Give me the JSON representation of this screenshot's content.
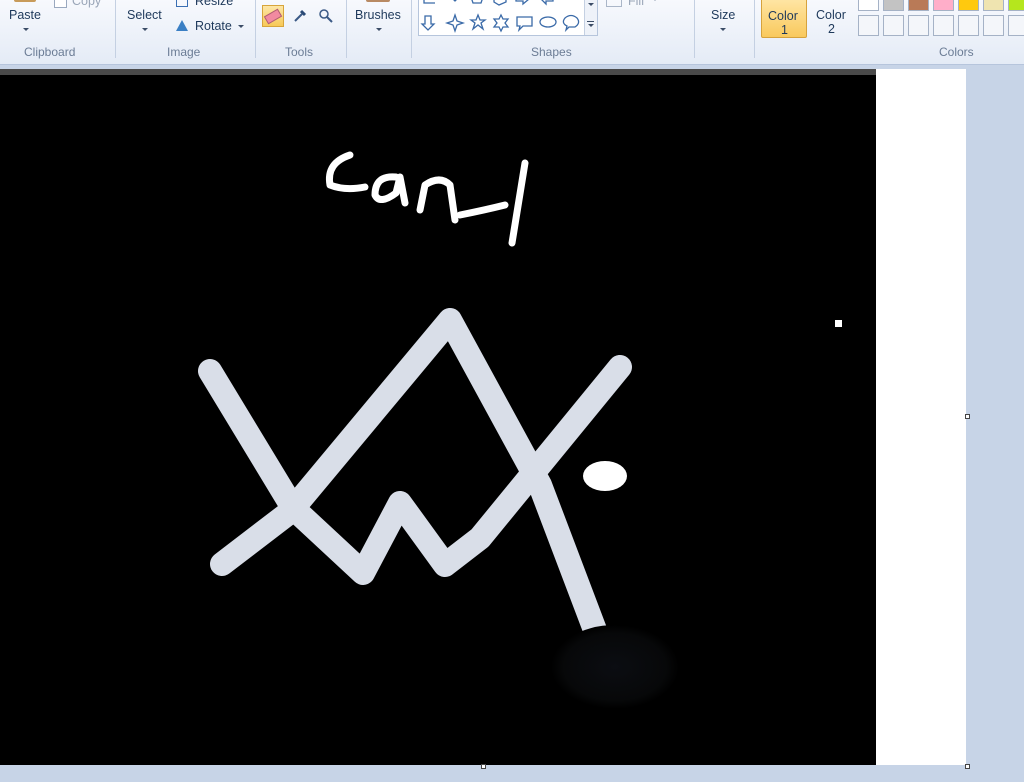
{
  "ribbon": {
    "clipboard": {
      "paste_label": "Paste",
      "copy_label": "Copy",
      "group_label": "Clipboard"
    },
    "image": {
      "select_label": "Select",
      "resize_label": "Resize",
      "rotate_label": "Rotate",
      "group_label": "Image"
    },
    "tools": {
      "group_label": "Tools",
      "active_tool": "eraser-icon"
    },
    "brushes": {
      "label": "Brushes"
    },
    "shapes": {
      "group_label": "Shapes",
      "fill_label": "Fill"
    },
    "size": {
      "label": "Size"
    },
    "colors": {
      "color1_label": "Color",
      "color1_num": "1",
      "color2_label": "Color",
      "color2_num": "2",
      "group_label": "Colors",
      "palette_top": [
        "#ffffff",
        "#c3c3c3",
        "#b97a57",
        "#ffaec9",
        "#ffc90e",
        "#efe4b0",
        "#b5e61d"
      ],
      "color1_value": "#000000"
    }
  },
  "canvas": {
    "background": "#000000",
    "handwritten_text": "canl"
  }
}
